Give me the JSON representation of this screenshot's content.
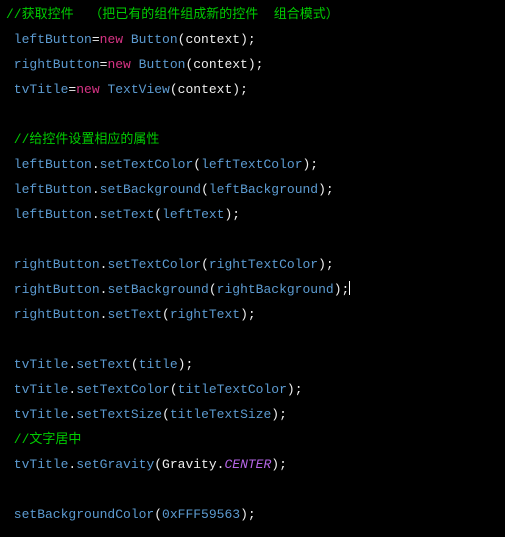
{
  "caret_line": 11,
  "lines": [
    [
      {
        "cls": "cm",
        "t": "//获取控件  （把已有的组件组成新的控件  组合模式）"
      }
    ],
    [
      {
        "cls": "id",
        "t": " leftButton"
      },
      {
        "cls": "pn",
        "t": "="
      },
      {
        "cls": "kw",
        "t": "new"
      },
      {
        "cls": "id",
        "t": " Button"
      },
      {
        "cls": "pn",
        "t": "(context);"
      }
    ],
    [
      {
        "cls": "id",
        "t": " rightButton"
      },
      {
        "cls": "pn",
        "t": "="
      },
      {
        "cls": "kw",
        "t": "new"
      },
      {
        "cls": "id",
        "t": " Button"
      },
      {
        "cls": "pn",
        "t": "(context);"
      }
    ],
    [
      {
        "cls": "id",
        "t": " tvTitle"
      },
      {
        "cls": "pn",
        "t": "="
      },
      {
        "cls": "kw",
        "t": "new"
      },
      {
        "cls": "id",
        "t": " TextView"
      },
      {
        "cls": "pn",
        "t": "(context);"
      }
    ],
    [
      {
        "cls": "pn",
        "t": " "
      }
    ],
    [
      {
        "cls": "cm",
        "t": " //给控件设置相应的属性"
      }
    ],
    [
      {
        "cls": "id",
        "t": " leftButton"
      },
      {
        "cls": "pn",
        "t": "."
      },
      {
        "cls": "id",
        "t": "setTextColor"
      },
      {
        "cls": "pn",
        "t": "("
      },
      {
        "cls": "id",
        "t": "leftTextColor"
      },
      {
        "cls": "pn",
        "t": ");"
      }
    ],
    [
      {
        "cls": "id",
        "t": " leftButton"
      },
      {
        "cls": "pn",
        "t": "."
      },
      {
        "cls": "id",
        "t": "setBackground"
      },
      {
        "cls": "pn",
        "t": "("
      },
      {
        "cls": "id",
        "t": "leftBackground"
      },
      {
        "cls": "pn",
        "t": ");"
      }
    ],
    [
      {
        "cls": "id",
        "t": " leftButton"
      },
      {
        "cls": "pn",
        "t": "."
      },
      {
        "cls": "id",
        "t": "setText"
      },
      {
        "cls": "pn",
        "t": "("
      },
      {
        "cls": "id",
        "t": "leftText"
      },
      {
        "cls": "pn",
        "t": ");"
      }
    ],
    [
      {
        "cls": "pn",
        "t": " "
      }
    ],
    [
      {
        "cls": "id",
        "t": " rightButton"
      },
      {
        "cls": "pn",
        "t": "."
      },
      {
        "cls": "id",
        "t": "setTextColor"
      },
      {
        "cls": "pn",
        "t": "("
      },
      {
        "cls": "id",
        "t": "rightTextColor"
      },
      {
        "cls": "pn",
        "t": ");"
      }
    ],
    [
      {
        "cls": "id",
        "t": " rightButton"
      },
      {
        "cls": "pn",
        "t": "."
      },
      {
        "cls": "id",
        "t": "setBackground"
      },
      {
        "cls": "pn",
        "t": "("
      },
      {
        "cls": "id",
        "t": "rightBackground"
      },
      {
        "cls": "pn",
        "t": ");"
      }
    ],
    [
      {
        "cls": "id",
        "t": " rightButton"
      },
      {
        "cls": "pn",
        "t": "."
      },
      {
        "cls": "id",
        "t": "setText"
      },
      {
        "cls": "pn",
        "t": "("
      },
      {
        "cls": "id",
        "t": "rightText"
      },
      {
        "cls": "pn",
        "t": ");"
      }
    ],
    [
      {
        "cls": "pn",
        "t": " "
      }
    ],
    [
      {
        "cls": "id",
        "t": " tvTitle"
      },
      {
        "cls": "pn",
        "t": "."
      },
      {
        "cls": "id",
        "t": "setText"
      },
      {
        "cls": "pn",
        "t": "("
      },
      {
        "cls": "id",
        "t": "title"
      },
      {
        "cls": "pn",
        "t": ");"
      }
    ],
    [
      {
        "cls": "id",
        "t": " tvTitle"
      },
      {
        "cls": "pn",
        "t": "."
      },
      {
        "cls": "id",
        "t": "setTextColor"
      },
      {
        "cls": "pn",
        "t": "("
      },
      {
        "cls": "id",
        "t": "titleTextColor"
      },
      {
        "cls": "pn",
        "t": ");"
      }
    ],
    [
      {
        "cls": "id",
        "t": " tvTitle"
      },
      {
        "cls": "pn",
        "t": "."
      },
      {
        "cls": "id",
        "t": "setTextSize"
      },
      {
        "cls": "pn",
        "t": "("
      },
      {
        "cls": "id",
        "t": "titleTextSize"
      },
      {
        "cls": "pn",
        "t": ");"
      }
    ],
    [
      {
        "cls": "cm",
        "t": " //文字居中"
      }
    ],
    [
      {
        "cls": "id",
        "t": " tvTitle"
      },
      {
        "cls": "pn",
        "t": "."
      },
      {
        "cls": "id",
        "t": "setGravity"
      },
      {
        "cls": "pn",
        "t": "(Gravity."
      },
      {
        "cls": "it",
        "t": "CENTER"
      },
      {
        "cls": "pn",
        "t": ");"
      }
    ],
    [
      {
        "cls": "pn",
        "t": " "
      }
    ],
    [
      {
        "cls": "id",
        "t": " setBackgroundColor"
      },
      {
        "cls": "pn",
        "t": "("
      },
      {
        "cls": "id",
        "t": "0xFFF59563"
      },
      {
        "cls": "pn",
        "t": ");"
      }
    ]
  ]
}
